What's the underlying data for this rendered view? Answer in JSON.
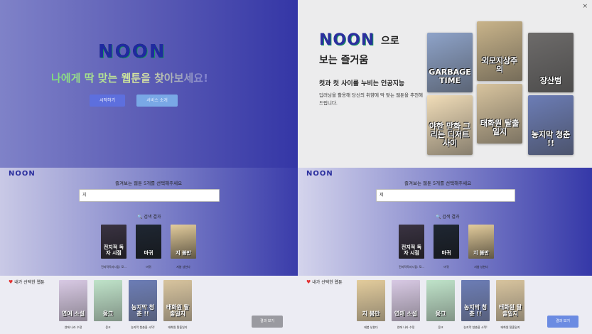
{
  "landing": {
    "logo": "NOON",
    "tagline": "나에게 딱 맞는 웹툰을 찾아보세요!",
    "start_button": "시작하기",
    "service_button": "서비스 소개"
  },
  "intro_modal": {
    "close": "×",
    "logo": "NOON",
    "headline_suffix": "으로",
    "headline_line2": "보는 즐거움",
    "subhead": "컷과 컷 사이를 누비는 인공지능",
    "description": "딥러닝을 활용해 당신의 취향에 딱 맞는 웹툰을 추천해드립니다.",
    "posters": [
      {
        "title": "GARBAGE TIME",
        "color": "#8ea3c9"
      },
      {
        "title": "외모지상주의",
        "color": "#c9b48a"
      },
      {
        "title": "장산범",
        "color": "#6d6b6a"
      },
      {
        "title": "야한 만화 그리는 디저트 사이",
        "color": "#f1ddb8"
      },
      {
        "title": "태화원 탈출일지",
        "color": "#d8c49e"
      },
      {
        "title": "농지막 청춘 !!",
        "color": "#6c7db6"
      }
    ]
  },
  "select_left": {
    "logo": "NOON",
    "title": "즐겨보는 웹툰 5개를 선택해주세요",
    "search_value": "지",
    "results_label": "검색 결과",
    "results": [
      {
        "title": "전지적 독자 시점",
        "caption": "전지적독자시점: 모...",
        "color": "#3a3342"
      },
      {
        "title": "마귀",
        "caption": "마귀",
        "color": "#1f2733"
      },
      {
        "title": "지 봄만",
        "caption": "지봄 넝한다",
        "color": "#e3cc9c"
      }
    ],
    "picked_label": "내가 선택한 웹툰",
    "picked": [
      {
        "title": "연애 소설",
        "caption": "연애 나라 수정",
        "color": "#d8c9e4"
      },
      {
        "title": "웅크",
        "caption": "웅크",
        "color": "#bfe3c9"
      },
      {
        "title": "농지막 청춘 !!",
        "caption": "농지막 청춘을 시작!",
        "color": "#6c7db6"
      },
      {
        "title": "태화원 탈출일지",
        "caption": "태화원 탈출일지",
        "color": "#d8c49e"
      }
    ],
    "result_button": "결과 보기"
  },
  "select_right": {
    "logo": "NOON",
    "title": "즐겨보는 웹툰 5개를 선택해주세요",
    "search_value": "제",
    "results_label": "검색 결과",
    "results": [
      {
        "title": "전지적 독자 시점",
        "caption": "전지적독자시점: 모...",
        "color": "#3a3342"
      },
      {
        "title": "마귀",
        "caption": "마귀",
        "color": "#1f2733"
      },
      {
        "title": "지 봄만",
        "caption": "지봄 넝한다",
        "color": "#e3cc9c"
      }
    ],
    "picked_label": "내가 선택한 웹툰",
    "picked": [
      {
        "title": "지 봄만",
        "caption": "제봄 넝한다",
        "color": "#e3cc9c"
      },
      {
        "title": "연애 소설",
        "caption": "연애 나라 수정",
        "color": "#d8c9e4"
      },
      {
        "title": "웅크",
        "caption": "웅크",
        "color": "#bfe3c9"
      },
      {
        "title": "농지막 청춘 !!",
        "caption": "농지막 청춘을 시작!",
        "color": "#6c7db6"
      },
      {
        "title": "태화원 탈출일지",
        "caption": "태화원 탈출일지",
        "color": "#d8c49e"
      }
    ],
    "result_button": "결과 보기"
  }
}
